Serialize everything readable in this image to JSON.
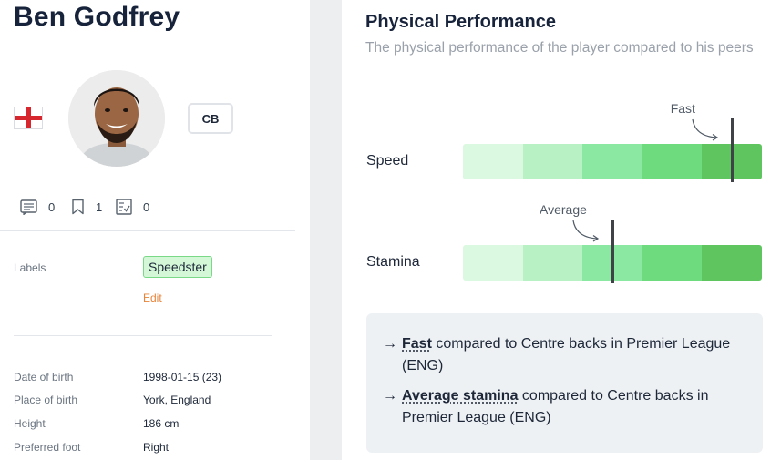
{
  "player": {
    "name": "Ben Godfrey",
    "nationality_flag": "england-flag",
    "position": "CB"
  },
  "stats": {
    "comments": "0",
    "bookmarks": "1",
    "reports": "0"
  },
  "labels": {
    "key": "Labels",
    "tag": "Speedster",
    "edit": "Edit"
  },
  "info": [
    {
      "key": "Date of birth",
      "value": "1998-01-15 (23)"
    },
    {
      "key": "Place of birth",
      "value": "York, England"
    },
    {
      "key": "Height",
      "value": "186 cm"
    },
    {
      "key": "Preferred foot",
      "value": "Right"
    }
  ],
  "physical": {
    "title": "Physical Performance",
    "subtitle": "The physical performance of the player compared to his peers",
    "scale_colors": [
      "#dbf8e1",
      "#b7f1c4",
      "#8be8a2",
      "#6fdb7f",
      "#5fc55f"
    ],
    "metrics": [
      {
        "label": "Speed",
        "callout": "Fast",
        "level": 0.9
      },
      {
        "label": "Stamina",
        "callout": "Average",
        "level": 0.5
      }
    ],
    "summary": [
      {
        "strong": "Fast",
        "rest": "compared to Centre backs in Premier League (ENG)"
      },
      {
        "strong": "Average stamina",
        "rest": "compared to Centre backs in Premier League (ENG)"
      }
    ]
  }
}
